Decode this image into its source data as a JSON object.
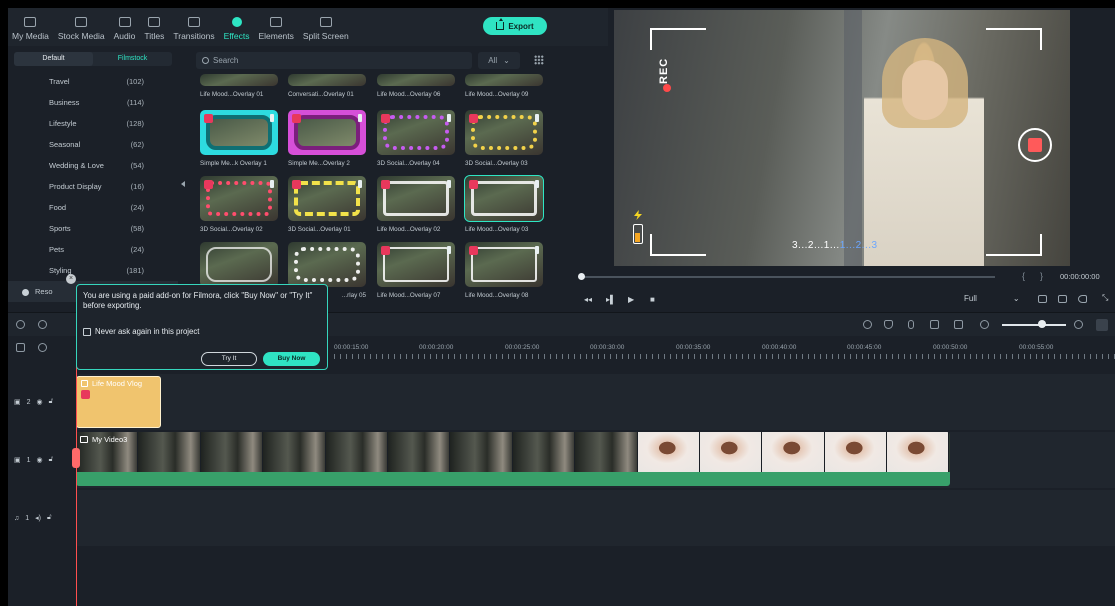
{
  "nav": {
    "tabs": [
      {
        "label": "My Media",
        "icon": "media-icon"
      },
      {
        "label": "Stock Media",
        "icon": "stock-icon"
      },
      {
        "label": "Audio",
        "icon": "music-icon"
      },
      {
        "label": "Titles",
        "icon": "title-icon"
      },
      {
        "label": "Transitions",
        "icon": "transition-icon"
      },
      {
        "label": "Effects",
        "icon": "sparkle-icon",
        "active": true
      },
      {
        "label": "Elements",
        "icon": "elements-icon"
      },
      {
        "label": "Split Screen",
        "icon": "split-icon"
      }
    ],
    "export_label": "Export"
  },
  "sidebar": {
    "tabs": [
      "Default",
      "Filmstock"
    ],
    "categories": [
      {
        "name": "Travel",
        "count": "(102)"
      },
      {
        "name": "Business",
        "count": "(114)"
      },
      {
        "name": "Lifestyle",
        "count": "(128)"
      },
      {
        "name": "Seasonal",
        "count": "(62)"
      },
      {
        "name": "Wedding & Love",
        "count": "(54)"
      },
      {
        "name": "Product Display",
        "count": "(16)"
      },
      {
        "name": "Food",
        "count": "(24)"
      },
      {
        "name": "Sports",
        "count": "(58)"
      },
      {
        "name": "Pets",
        "count": "(24)"
      },
      {
        "name": "Styling",
        "count": "(181)"
      }
    ],
    "resource_label": "Reso"
  },
  "effects": {
    "search_placeholder": "Search",
    "filter_label": "All",
    "rows": [
      [
        "Life Mood...Overlay 01",
        "Conversati...Overlay 01",
        "Life Mood...Overlay 06",
        "Life Mood...Overlay 09"
      ],
      [
        "Simple Me...k Overlay 1",
        "Simple Me...Overlay 2",
        "3D Social...Overlay 04",
        "3D Social...Overlay 03"
      ],
      [
        "3D Social...Overlay 02",
        "3D Social...Overlay 01",
        "Life Mood...Overlay 02",
        "Life Mood...Overlay 03"
      ],
      [
        "",
        "...rlay 05",
        "Life Mood...Overlay 07",
        "Life Mood...Overlay 08"
      ]
    ],
    "frame_colors": {
      "row1": [
        "#2ddbe0",
        "#d64fd8",
        "#c65cf0",
        "#f2d24a"
      ],
      "row2": [
        "#ff4d6d",
        "#f2e24a",
        "#ffffff",
        "#ffffff"
      ]
    }
  },
  "preview": {
    "rec_label": "REC",
    "countdown": "3...2...1...",
    "countdown_blue": "1...2...3",
    "timecode": "00:00:00:00",
    "quality": "Full"
  },
  "timeline": {
    "ruler": [
      "00:00:15:00",
      "00:00:20:00",
      "00:00:25:00",
      "00:00:30:00",
      "00:00:35:00",
      "00:00:40:00",
      "00:00:45:00",
      "00:00:50:00",
      "00:00:55:00"
    ],
    "tracks": {
      "overlay_track": "2",
      "video_track": "1",
      "audio_track": "1"
    },
    "overlay_clip": "Life Mood Vlog",
    "video_clip": "My Video3"
  },
  "popup": {
    "message": "You are using a paid add-on for Filmora, click \"Buy Now\" or \"Try It\" before exporting.",
    "checkbox_label": "Never ask again in this project",
    "try_label": "Try It",
    "buy_label": "Buy Now"
  }
}
